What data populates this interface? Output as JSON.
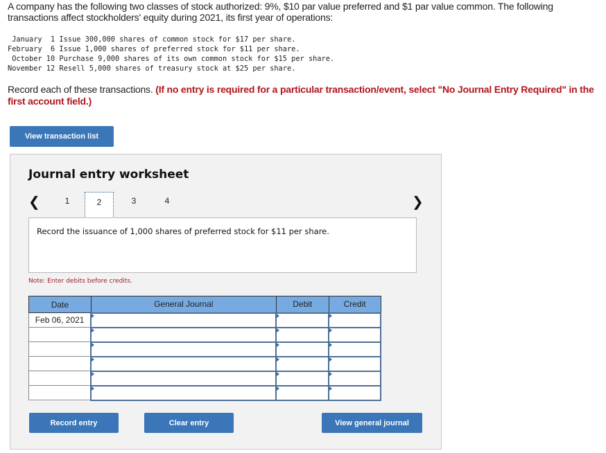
{
  "problem": {
    "intro": "A company has the following two classes of stock authorized: 9%, $10 par value preferred and $1 par value common. The following transactions affect stockholders' equity during 2021, its first year of operations:",
    "transactions": [
      " January  1 Issue 300,000 shares of common stock for $17 per share.",
      "February  6 Issue 1,000 shares of preferred stock for $11 per share.",
      " October 10 Purchase 9,000 shares of its own common stock for $15 per share.",
      "November 12 Resell 5,000 shares of treasury stock at $25 per share."
    ],
    "instruction_plain": "Record each of these transactions. ",
    "instruction_emphasis": "(If no entry is required for a particular transaction/event, select \"No Journal Entry Required\" in the first account field.)"
  },
  "buttons": {
    "view_transaction_list": "View transaction list",
    "record_entry": "Record entry",
    "clear_entry": "Clear entry",
    "view_general_journal": "View general journal"
  },
  "worksheet": {
    "title": "Journal entry worksheet",
    "pager": {
      "prev_icon": "chevron-left",
      "next_icon": "chevron-right",
      "pages": [
        "1",
        "2",
        "3",
        "4"
      ],
      "active_page": "2"
    },
    "prompt": "Record the issuance of 1,000 shares of preferred stock for $11 per share.",
    "note": "Note: Enter debits before credits.",
    "table": {
      "headers": [
        "Date",
        "General Journal",
        "Debit",
        "Credit"
      ],
      "rows": [
        {
          "date": "Feb 06, 2021",
          "account": "",
          "debit": "",
          "credit": ""
        },
        {
          "date": "",
          "account": "",
          "debit": "",
          "credit": ""
        },
        {
          "date": "",
          "account": "",
          "debit": "",
          "credit": ""
        },
        {
          "date": "",
          "account": "",
          "debit": "",
          "credit": ""
        },
        {
          "date": "",
          "account": "",
          "debit": "",
          "credit": ""
        },
        {
          "date": "",
          "account": "",
          "debit": "",
          "credit": ""
        }
      ]
    }
  },
  "colors": {
    "button_blue": "#3a76b8",
    "header_blue": "#76aae0",
    "emphasis_red": "#b0151b",
    "note_red": "#9a1e22",
    "panel_bg": "#f2f2f2"
  }
}
